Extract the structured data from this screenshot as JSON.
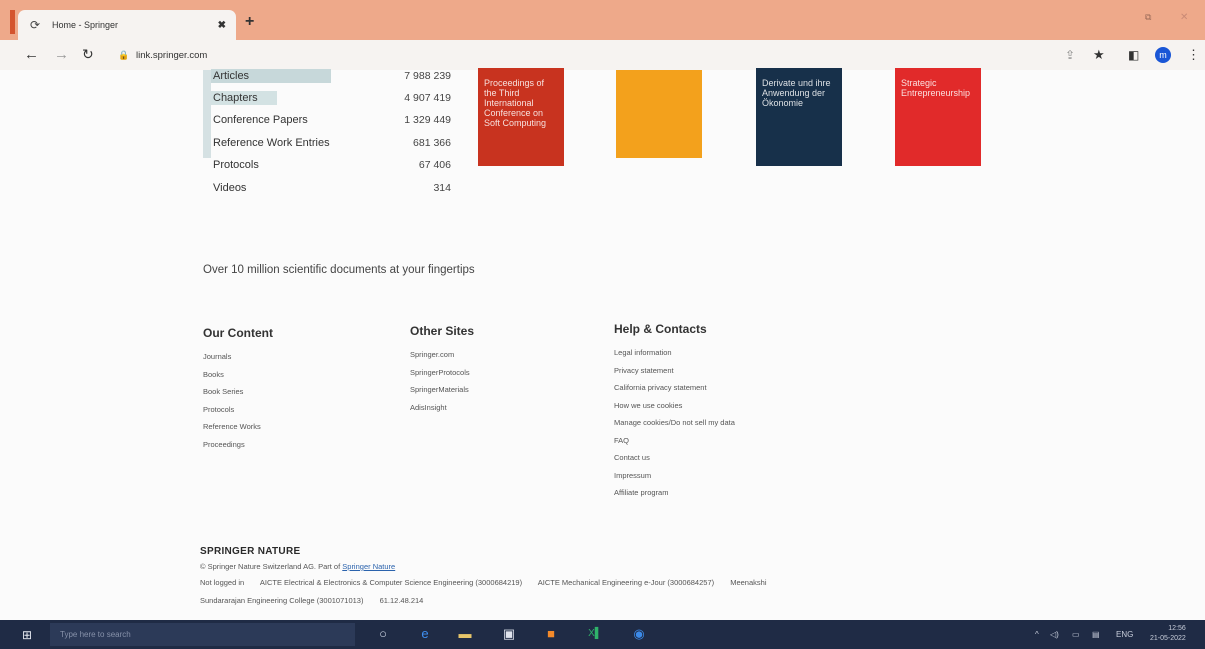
{
  "browser": {
    "tab_title": "Home - Springer",
    "tab_close": "✖",
    "new_tab": "+",
    "url": "link.springer.com",
    "profile_initial": "m",
    "win_min": "⧉",
    "win_close": "✕"
  },
  "stats": [
    {
      "label": "Articles",
      "value": "7 988 239"
    },
    {
      "label": "Chapters",
      "value": "4 907 419"
    },
    {
      "label": "Conference Papers",
      "value": "1 329 449"
    },
    {
      "label": "Reference Work Entries",
      "value": "681 366"
    },
    {
      "label": "Protocols",
      "value": "67 406"
    },
    {
      "label": "Videos",
      "value": "314"
    }
  ],
  "books": [
    {
      "title": "Proceedings of the Third International Conference on Soft Computing",
      "color": "#c8331f"
    },
    {
      "title": "",
      "color": "#f3a11c"
    },
    {
      "title": "Derivate und ihre Anwendung der Ökonomie",
      "color": "#17304a"
    },
    {
      "title": "Strategic Entrepreneurship",
      "color": "#e12a2a"
    }
  ],
  "tagline": "Over 10 million scientific documents at your fingertips",
  "footer": {
    "our_content": {
      "heading": "Our Content",
      "links": [
        "Journals",
        "Books",
        "Book Series",
        "Protocols",
        "Reference Works",
        "Proceedings"
      ]
    },
    "other_sites": {
      "heading": "Other Sites",
      "links": [
        "Springer.com",
        "SpringerProtocols",
        "SpringerMaterials",
        "AdisInsight"
      ]
    },
    "help": {
      "heading": "Help & Contacts",
      "links": [
        "Legal information",
        "Privacy statement",
        "California privacy statement",
        "How we use cookies",
        "Manage cookies/Do not sell my data",
        "FAQ",
        "Contact us",
        "Impressum",
        "Affiliate program"
      ]
    }
  },
  "legal": {
    "brand": "SPRINGER NATURE",
    "copyright_prefix": "© Springer Nature Switzerland AG. Part of",
    "copyright_link": "Springer Nature",
    "not_logged_in": "Not logged in",
    "inst1": "AICTE Electrical & Electronics & Computer Science Engineering (3000684219)",
    "inst2": "AICTE Mechanical Engineering e-Jour (3000684257)",
    "inst3": "Meenakshi",
    "inst4": "Sundararajan Engineering College (3001071013)",
    "ip": "61.12.48.214"
  },
  "taskbar": {
    "search_placeholder": "Type here to search",
    "tray_lang": "ENG",
    "time": "12:56",
    "date": "21-05-2022"
  }
}
